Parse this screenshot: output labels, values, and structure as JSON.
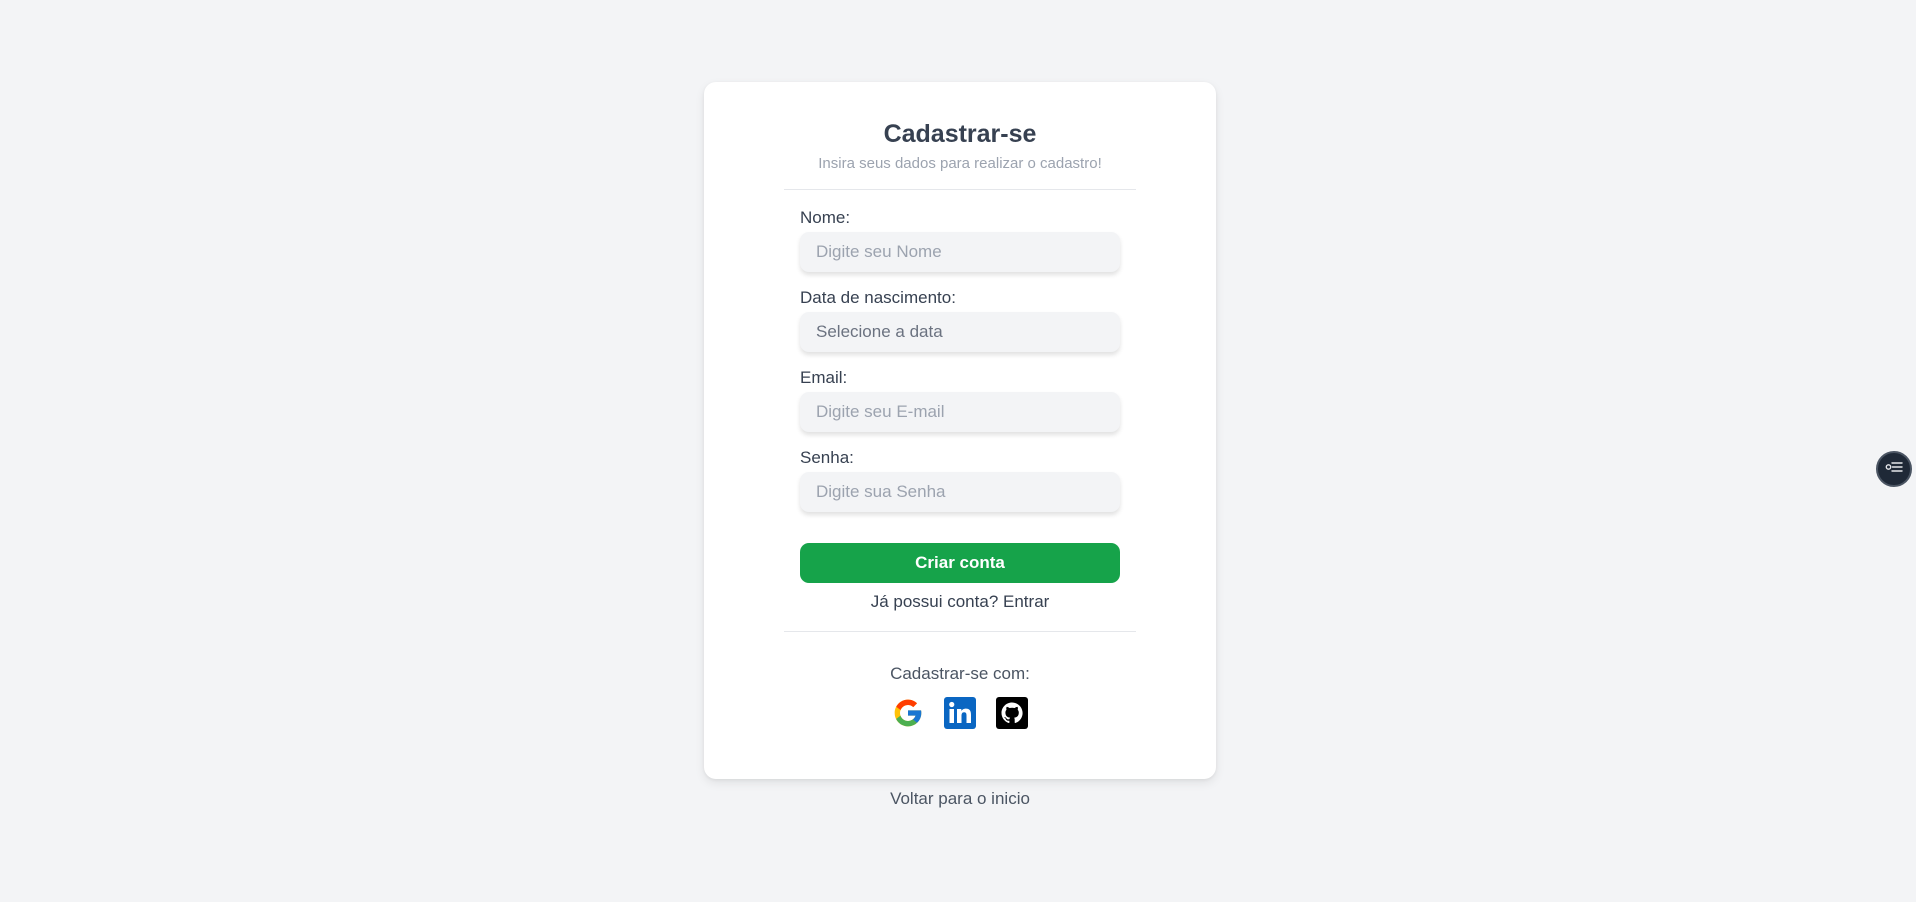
{
  "form": {
    "title": "Cadastrar-se",
    "subtitle": "Insira seus dados para realizar o cadastro!",
    "fields": {
      "name": {
        "label": "Nome:",
        "placeholder": "Digite seu Nome"
      },
      "birthdate": {
        "label": "Data de nascimento:",
        "placeholder": "Selecione a data"
      },
      "email": {
        "label": "Email:",
        "placeholder": "Digite seu E-mail"
      },
      "password": {
        "label": "Senha:",
        "placeholder": "Digite sua Senha"
      }
    },
    "submit_label": "Criar conta",
    "login_prompt": "Já possui conta?",
    "login_link": "Entrar",
    "social_label": "Cadastrar-se com:",
    "social_icons": [
      "google-icon",
      "linkedin-icon",
      "github-icon"
    ]
  },
  "back_link": "Voltar para o inicio",
  "floating_button_icon": "settings-list-icon",
  "colors": {
    "background": "#f3f4f6",
    "card": "#ffffff",
    "primary_button": "#16a34a",
    "linkedin": "#0a66c2",
    "github": "#000000"
  }
}
